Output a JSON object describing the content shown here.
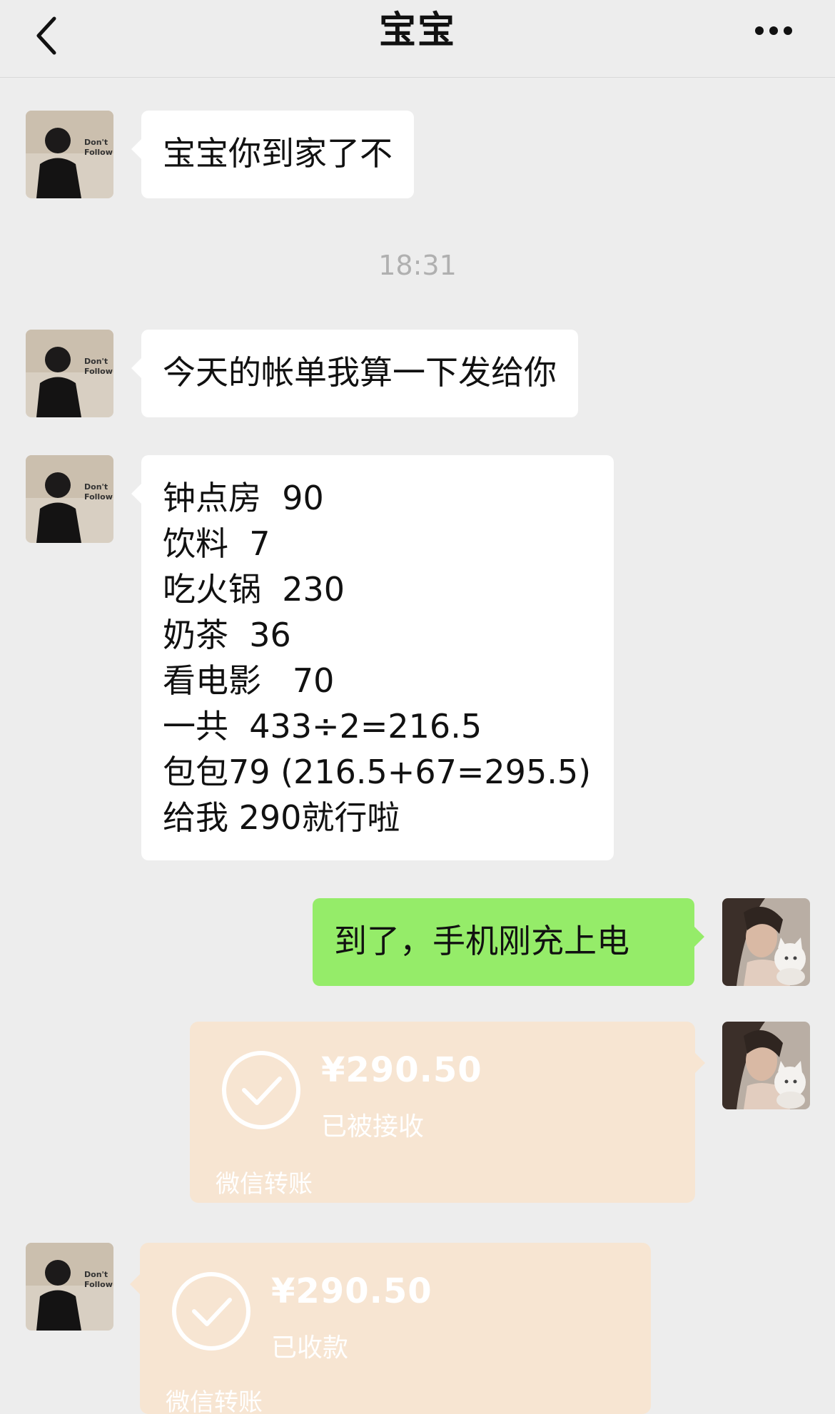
{
  "header": {
    "title": "宝宝",
    "back_icon": "chevron-left-icon",
    "more_icon": "more-dots-icon"
  },
  "messages": [
    {
      "from": "other",
      "type": "text",
      "text": "宝宝你到家了不"
    },
    {
      "type": "timestamp",
      "text": "18:31"
    },
    {
      "from": "other",
      "type": "text",
      "text": "今天的帐单我算一下发给你"
    },
    {
      "from": "other",
      "type": "text",
      "lines": [
        "钟点房  90",
        "饮料  7",
        "吃火锅  230",
        "奶茶  36",
        "看电影   70",
        "一共  433÷2=216.5",
        "包包79 (216.5+67=295.5)",
        "给我 290就行啦"
      ]
    },
    {
      "from": "me",
      "type": "text",
      "text": "到了，手机刚充上电"
    },
    {
      "from": "me",
      "type": "transfer",
      "amount": "¥290.50",
      "status": "已被接收",
      "label": "微信转账"
    },
    {
      "from": "other",
      "type": "transfer",
      "amount": "¥290.50",
      "status": "已收款",
      "label": "微信转账"
    }
  ],
  "colors": {
    "background": "#ededed",
    "bubble_me": "#95ec69",
    "bubble_other": "#ffffff",
    "transfer_done": "#f7e5d2"
  },
  "avatars": {
    "other_avatar_text": "Don't Follow"
  }
}
